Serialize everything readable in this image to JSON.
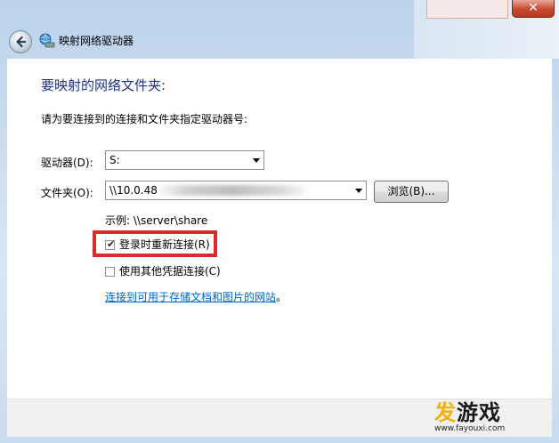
{
  "window": {
    "title": "映射网络驱动器",
    "close_glyph": "✕"
  },
  "main": {
    "heading": "要映射的网络文件夹:",
    "instruction": "请为要连接到的连接和文件夹指定驱动器号:",
    "drive": {
      "label": "驱动器(D):",
      "value": "S:"
    },
    "folder": {
      "label": "文件夹(O):",
      "value": "\\\\10.0.48"
    },
    "browse_label": "浏览(B)...",
    "example": "示例: \\\\server\\share",
    "reconnect": {
      "label": "登录时重新连接(R)",
      "checked": true
    },
    "other_credentials": {
      "label": "使用其他凭据连接(C)",
      "checked": false
    },
    "link_text": "连接到可用于存储文档和图片的网站",
    "link_suffix": "。"
  },
  "watermark": {
    "logo_part1": "发",
    "logo_part2": "游戏",
    "url": "www.fayouxi.com"
  },
  "colors": {
    "heading": "#1e3287",
    "link": "#0066cc",
    "highlight": "#e02a2a"
  }
}
